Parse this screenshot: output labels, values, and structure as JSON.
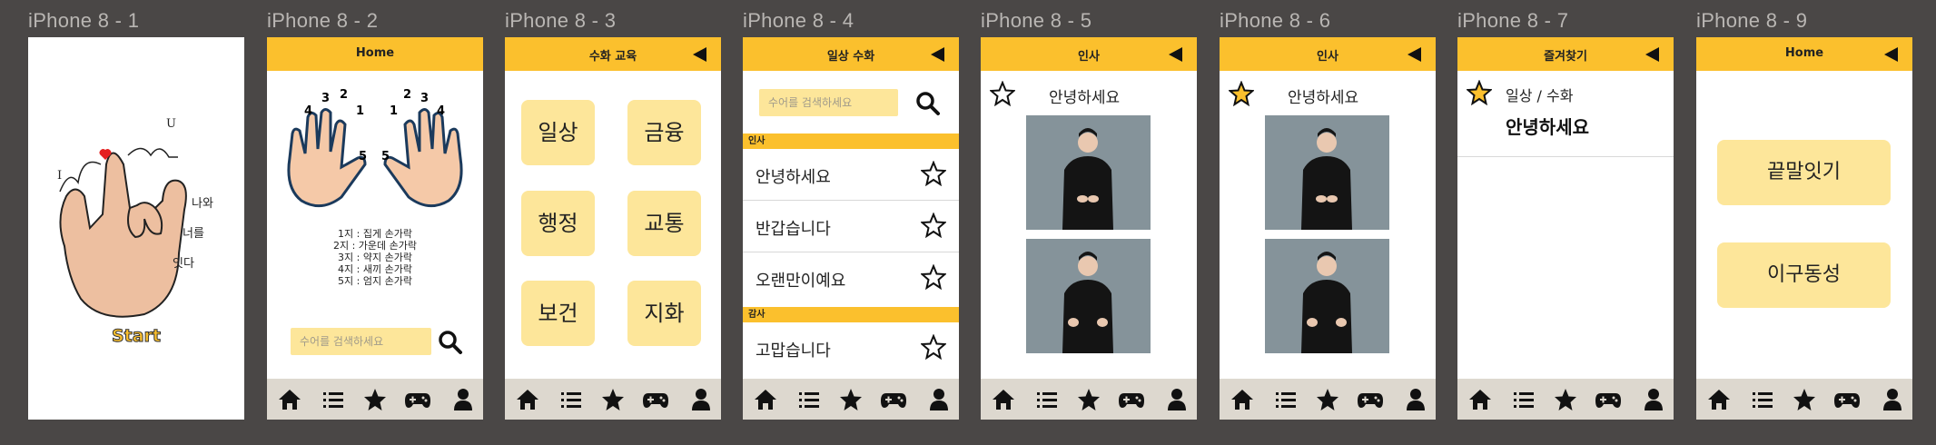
{
  "frames": [
    {
      "label": "iPhone 8 - 1"
    },
    {
      "label": "iPhone 8 - 2"
    },
    {
      "label": "iPhone 8 - 3"
    },
    {
      "label": "iPhone 8 - 4"
    },
    {
      "label": "iPhone 8 - 5"
    },
    {
      "label": "iPhone 8 - 6"
    },
    {
      "label": "iPhone 8 - 7"
    },
    {
      "label": "iPhone 8 - 9"
    }
  ],
  "splash": {
    "letter_i": "I",
    "letter_u": "U",
    "text_line1": "나와",
    "text_line2": "너를",
    "text_line3": "잇다",
    "start": "Start"
  },
  "home": {
    "title": "Home",
    "finger_numbers_left": [
      "1",
      "2",
      "3",
      "4",
      "5"
    ],
    "finger_numbers_right": [
      "1",
      "2",
      "3",
      "4",
      "5"
    ],
    "legend": [
      "1지 : 집게 손가락",
      "2지 : 가운데 손가락",
      "3지 : 약지 손가락",
      "4지 : 새끼 손가락",
      "5지 : 엄지 손가락"
    ],
    "search_placeholder": "수어를 검색하세요"
  },
  "education": {
    "title": "수화 교육",
    "categories": [
      "일상",
      "금융",
      "행정",
      "교통",
      "보건",
      "지화"
    ]
  },
  "daily": {
    "title": "일상 수화",
    "search_placeholder": "수어를 검색하세요",
    "section1": "인사",
    "items1": [
      "안녕하세요",
      "반갑습니다",
      "오랜만이예요"
    ],
    "section2": "감사",
    "items2": [
      "고맙습니다"
    ]
  },
  "detail5": {
    "title": "인사",
    "word": "안녕하세요",
    "favorited": false
  },
  "detail6": {
    "title": "인사",
    "word": "안녕하세요",
    "favorited": true
  },
  "favorites": {
    "title": "즐겨찾기",
    "category": "일상 / 수화",
    "word": "안녕하세요"
  },
  "games": {
    "title": "Home",
    "buttons": [
      "끝말잇기",
      "이구동성"
    ]
  },
  "nav_icons": [
    "home-icon",
    "list-icon",
    "star-icon",
    "gamepad-icon",
    "user-icon"
  ],
  "colors": {
    "accent": "#fbc02d",
    "tile": "#fde69a",
    "nav": "#ddd8cf",
    "canvas": "#4a4746"
  }
}
